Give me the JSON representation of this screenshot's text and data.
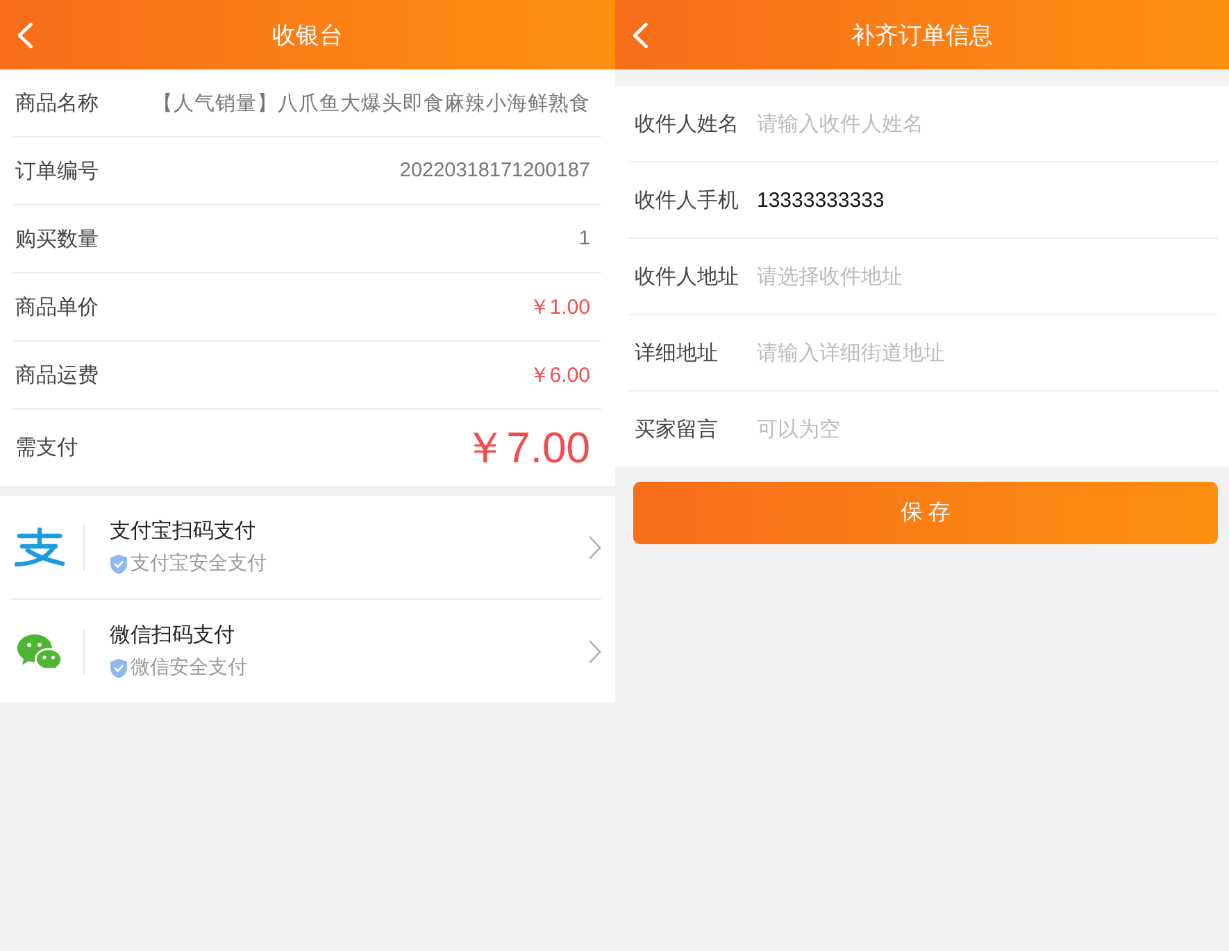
{
  "cashier": {
    "title": "收银台",
    "rows": [
      {
        "label": "商品名称",
        "value": "【人气销量】八爪鱼大爆头即食麻辣小海鲜熟食",
        "kind": "text"
      },
      {
        "label": "订单编号",
        "value": "20220318171200187",
        "kind": "text"
      },
      {
        "label": "购买数量",
        "value": "1",
        "kind": "text"
      },
      {
        "label": "商品单价",
        "value": "￥1.00",
        "kind": "price"
      },
      {
        "label": "商品运费",
        "value": "￥6.00",
        "kind": "price"
      },
      {
        "label": "需支付",
        "value": "￥7.00",
        "kind": "total"
      }
    ],
    "payment_methods": [
      {
        "name": "支付宝扫码支付",
        "note": "支付宝安全支付",
        "kind": "alipay"
      },
      {
        "name": "微信扫码支付",
        "note": "微信安全支付",
        "kind": "wechat"
      }
    ]
  },
  "order_form": {
    "title": "补齐订单信息",
    "fields": [
      {
        "label": "收件人姓名",
        "placeholder": "请输入收件人姓名"
      },
      {
        "label": "收件人手机",
        "value": "13333333333"
      },
      {
        "label": "收件人地址",
        "placeholder": "请选择收件地址"
      },
      {
        "label": "详细地址",
        "placeholder": "请输入详细街道地址"
      },
      {
        "label": "买家留言",
        "placeholder": "可以为空"
      }
    ],
    "save_button": "保 存"
  }
}
